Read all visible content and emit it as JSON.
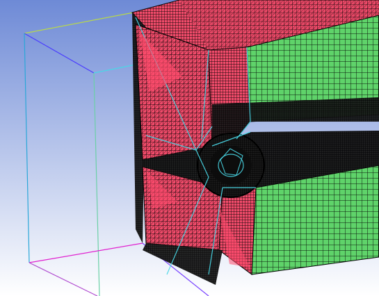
{
  "viewport": {
    "background": {
      "top": "#6e8ad6",
      "bottom": "#ffffff"
    },
    "overlay_text": "",
    "colors": {
      "red_mesh_face": "#f04b6a",
      "green_mesh_face": "#5fd36a",
      "mesh_edges": "#000000",
      "bounding_box_left": "#2aa7d8",
      "bounding_box_bottom": "#e021d0",
      "bounding_box_top": "#b8d84a",
      "bounding_box_right": "#4a3cff",
      "geometry_lines": "#49d7e6"
    },
    "icons": [
      "bounding-box",
      "mesh-block",
      "pipe-hole"
    ]
  }
}
